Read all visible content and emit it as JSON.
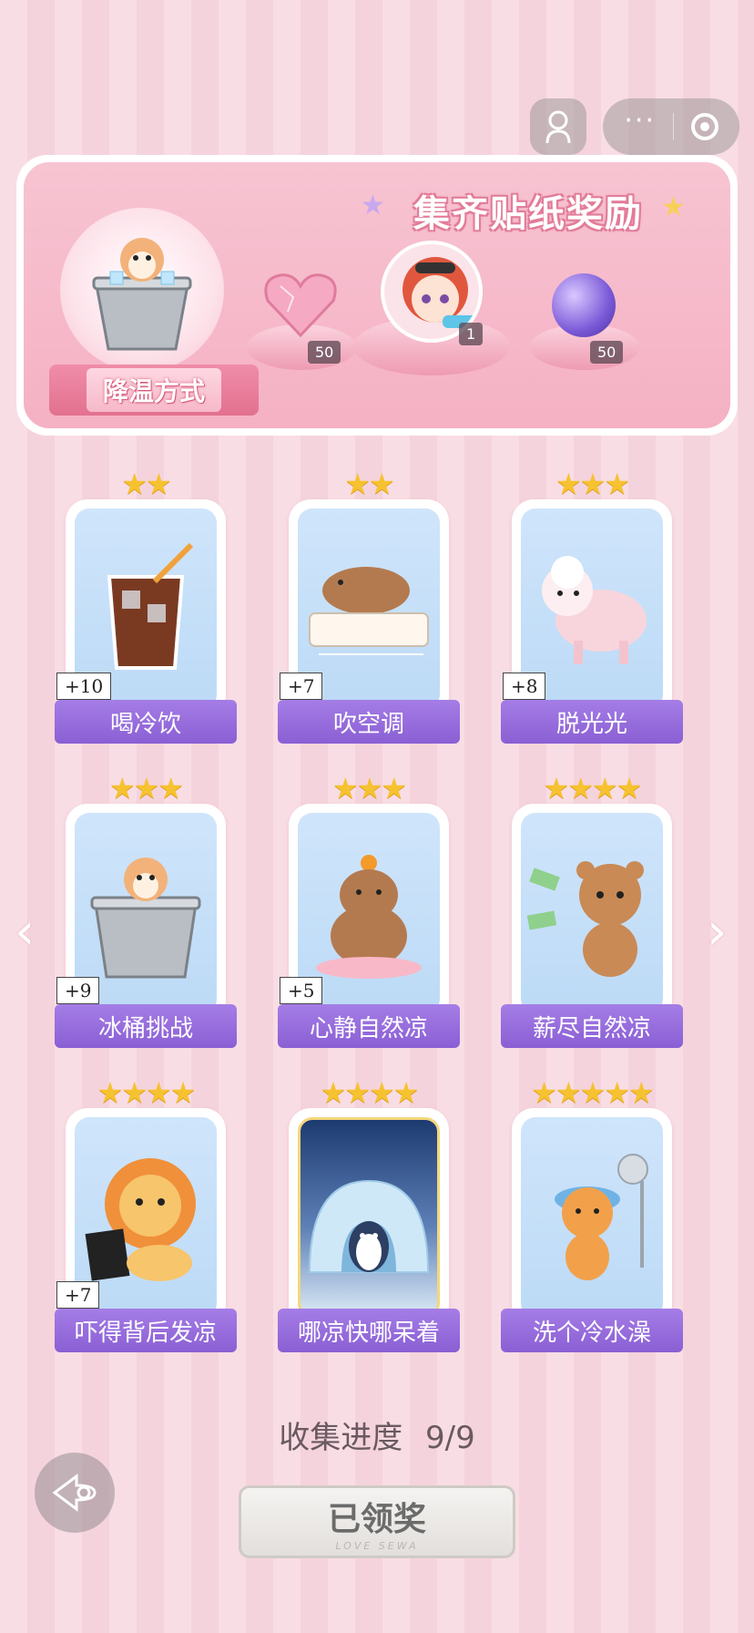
{
  "banner": {
    "title": "集齐贴纸奖励",
    "badge_label": "降温方式",
    "rewards": [
      {
        "name": "heart-gem",
        "count": "50"
      },
      {
        "name": "character-avatar",
        "count": "1"
      },
      {
        "name": "purple-orb",
        "count": "50"
      }
    ]
  },
  "cards": [
    {
      "label": "喝冷饮",
      "bonus": "+10",
      "stars": "★★",
      "icon": "iced-drink"
    },
    {
      "label": "吹空调",
      "bonus": "+7",
      "stars": "★★",
      "icon": "capybara-air-conditioner"
    },
    {
      "label": "脱光光",
      "bonus": "+8",
      "stars": "★★★",
      "icon": "sheared-sheep"
    },
    {
      "label": "冰桶挑战",
      "bonus": "+9",
      "stars": "★★★",
      "icon": "hamster-ice-bucket"
    },
    {
      "label": "心静自然凉",
      "bonus": "+5",
      "stars": "★★★",
      "icon": "meditating-capybara"
    },
    {
      "label": "薪尽自然凉",
      "bonus": "",
      "stars": "★★★★",
      "icon": "crying-bear-money"
    },
    {
      "label": "吓得背后发凉",
      "bonus": "+7",
      "stars": "★★★★",
      "icon": "scared-lion"
    },
    {
      "label": "哪凉快哪呆着",
      "bonus": "",
      "stars": "★★★★",
      "icon": "penguin-igloo"
    },
    {
      "label": "洗个冷水澡",
      "bonus": "",
      "stars": "★★★★★",
      "icon": "cat-shower"
    }
  ],
  "progress": {
    "label": "收集进度",
    "value": "9/9"
  },
  "claim_button": {
    "label": "已领奖",
    "sub": "LOVE SEWA"
  },
  "nav": {
    "left_arrow": "‹",
    "right_arrow": "›"
  },
  "capsule": {
    "more": "···"
  }
}
